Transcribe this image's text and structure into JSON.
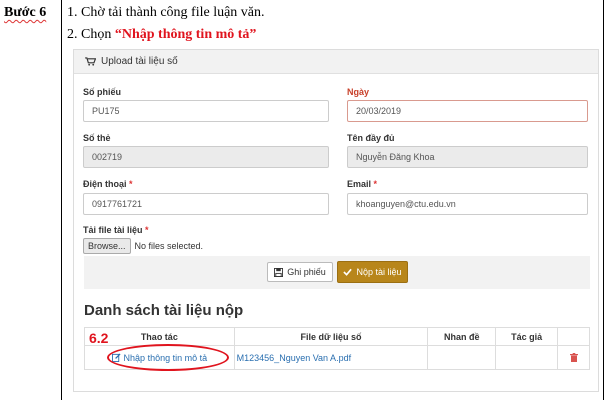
{
  "step": {
    "label": "Bước 6"
  },
  "instructions": {
    "line1": "1. Chờ tải thành công file luận văn.",
    "line2_prefix": "2. Chọn ",
    "line2_emphasis": "“Nhập thông tin mô tả”"
  },
  "panel": {
    "title": "Upload tài liệu số",
    "fields": {
      "so_phieu": {
        "label": "Số phiếu",
        "value": "PU175"
      },
      "ngay": {
        "label": "Ngày",
        "value": "20/03/2019"
      },
      "so_the": {
        "label": "Số thẻ",
        "value": "002719"
      },
      "ten_day_du": {
        "label": "Tên đầy đủ",
        "value": "Nguyễn Đăng Khoa"
      },
      "dien_thoai": {
        "label": "Điện thoại",
        "required": "*",
        "value": "0917761721"
      },
      "email": {
        "label": "Email",
        "required": "*",
        "value": "khoanguyen@ctu.edu.vn"
      },
      "tai_file": {
        "label": "Tải file tài liệu",
        "required": "*",
        "browse": "Browse...",
        "status": "No files selected."
      }
    },
    "buttons": {
      "save": "Ghi phiếu",
      "submit": "Nộp tài liệu"
    }
  },
  "list": {
    "title": "Danh sách tài liệu nộp",
    "columns": [
      "Thao tác",
      "File dữ liệu số",
      "Nhan đề",
      "Tác giả"
    ],
    "row": {
      "action": "Nhập thông tin mô tả",
      "file": "M123456_Nguyen Van A.pdf",
      "title": "",
      "author": ""
    },
    "annotation": "6.2"
  },
  "colors": {
    "accent_red": "#e0141e",
    "submit_gold": "#b8861b",
    "link_blue": "#2a6fb0"
  }
}
